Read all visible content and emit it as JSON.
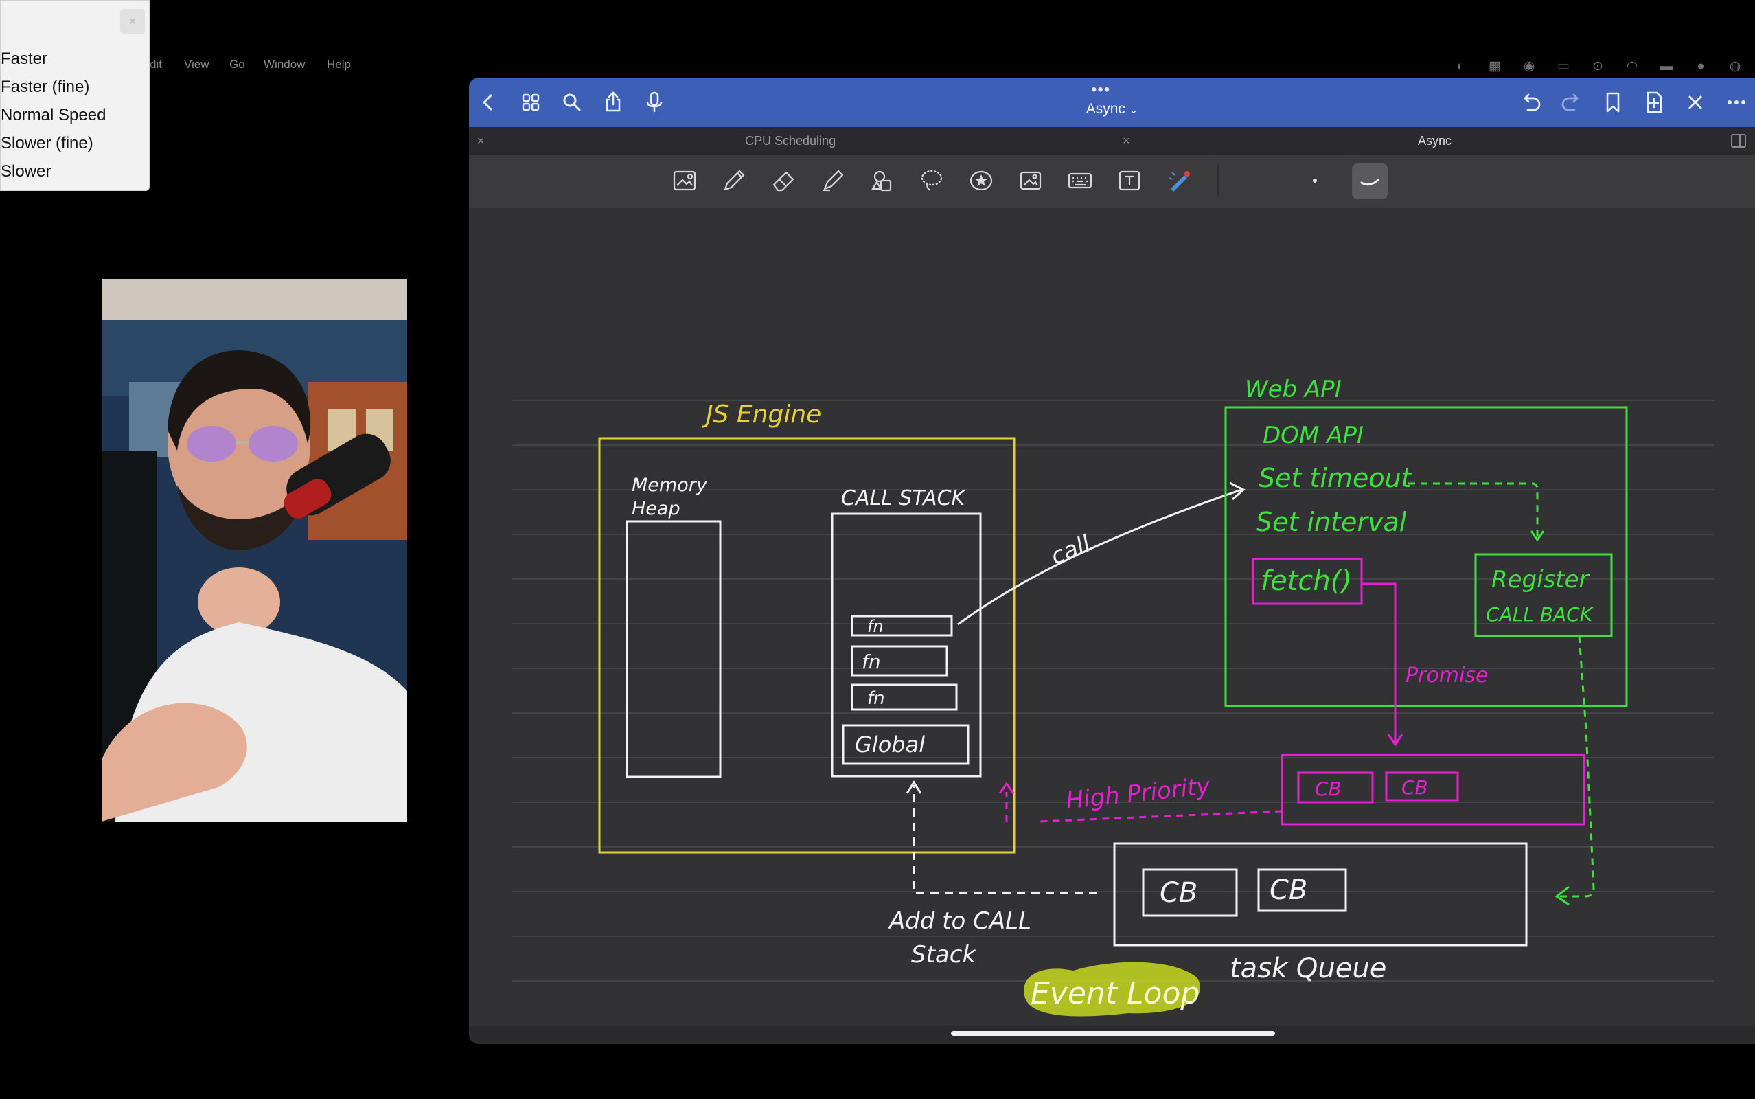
{
  "menubar": {
    "items": [
      "dit",
      "View",
      "Go",
      "Window",
      "Help"
    ]
  },
  "speed_menu": {
    "close_glyph": "×",
    "options": [
      "Faster",
      "Faster (fine)",
      "Normal Speed",
      "Slower (fine)",
      "Slower"
    ]
  },
  "app": {
    "title": "Async",
    "title_chevron": "⌄",
    "tabs": [
      {
        "label": "CPU Scheduling",
        "close": "×"
      },
      {
        "label": "Async",
        "close": "×"
      }
    ]
  },
  "diagram": {
    "js_engine": "JS Engine",
    "memory_heap": [
      "Memory",
      "Heap"
    ],
    "call_stack": "CALL STACK",
    "stack_frames": [
      "fn",
      "fn",
      "fn"
    ],
    "global_frame": "Global",
    "call_label": "call",
    "web_api": "Web API",
    "dom_api": "DOM API",
    "set_timeout": "Set timeout",
    "set_interval": "Set interval",
    "fetch": "fetch()",
    "register": [
      "Register",
      "CALL BACK"
    ],
    "promise": "Promise",
    "high_priority": "High Priority",
    "microtask_cbs": [
      "CB",
      "CB"
    ],
    "task_cbs": [
      "CB",
      "CB"
    ],
    "add_to_call_stack": [
      "Add to CALL",
      "Stack"
    ],
    "task_queue": "task Queue",
    "event_loop": "Event Loop"
  },
  "colors": {
    "nav_blue": "#3d5fb5",
    "ink_white": "#f2f2f2",
    "ink_yellow": "#e7d034",
    "ink_green": "#3de03d",
    "ink_magenta": "#e81ed1",
    "highlighter": "#c7d81f"
  }
}
